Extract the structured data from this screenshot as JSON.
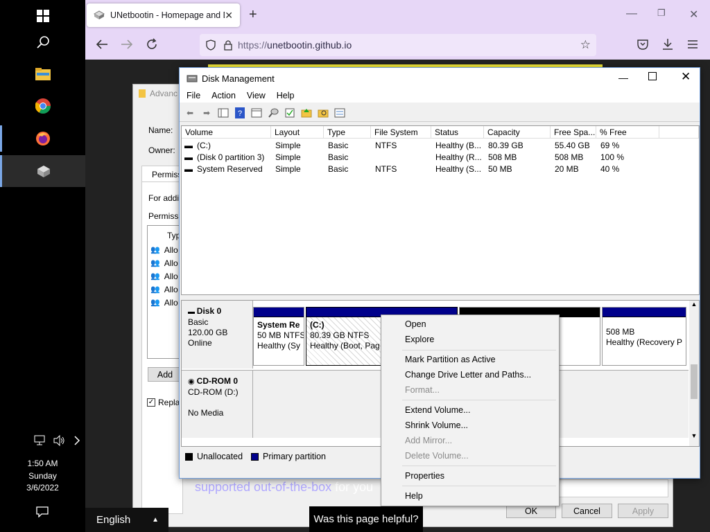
{
  "taskbar": {
    "clock_time": "1:50 AM",
    "clock_day": "Sunday",
    "clock_date": "3/6/2022"
  },
  "browser": {
    "tab_title": "UNetbootin - Homepage and D",
    "url_prefix": "https://",
    "url_host": "unetbootin.github.io",
    "page_text_link": "supported out-of-the-box",
    "page_text_rest": " for you",
    "helpful_label": "Was this page helpful?",
    "language_label": "English"
  },
  "adv_dialog": {
    "title": "Advanc",
    "name_label": "Name:",
    "owner_label": "Owner:",
    "tab_label": "Permiss",
    "for_addl": "For addi",
    "perm_label": "Permissi",
    "type_header": "Typ",
    "entries": [
      "Allo",
      "Allo",
      "Allo",
      "Allo",
      "Allo"
    ],
    "add_btn": "Add",
    "replace_chk": "Replac",
    "ok_btn": "OK",
    "cancel_btn": "Cancel",
    "apply_btn": "Apply"
  },
  "disk_mgmt": {
    "title": "Disk Management",
    "menu": [
      "File",
      "Action",
      "View",
      "Help"
    ],
    "columns": [
      "Volume",
      "Layout",
      "Type",
      "File System",
      "Status",
      "Capacity",
      "Free Spa...",
      "% Free"
    ],
    "rows": [
      [
        "(C:)",
        "Simple",
        "Basic",
        "NTFS",
        "Healthy (B...",
        "80.39 GB",
        "55.40 GB",
        "69 %"
      ],
      [
        "(Disk 0 partition 3)",
        "Simple",
        "Basic",
        "",
        "Healthy (R...",
        "508 MB",
        "508 MB",
        "100 %"
      ],
      [
        "System Reserved",
        "Simple",
        "Basic",
        "NTFS",
        "Healthy (S...",
        "50 MB",
        "20 MB",
        "40 %"
      ]
    ],
    "disk0": {
      "name": "Disk 0",
      "type": "Basic",
      "size": "120.00 GB",
      "state": "Online"
    },
    "cdrom0": {
      "name": "CD-ROM 0",
      "drive": "CD-ROM (D:)",
      "media": "No Media"
    },
    "partitions": {
      "sysres": {
        "name": "System Re",
        "size": "50 MB NTFS",
        "status": "Healthy (Sy"
      },
      "c": {
        "name": "(C:)",
        "size": "80.39 GB NTFS",
        "status": "Healthy (Boot, Pag"
      },
      "recovery": {
        "size": "508 MB",
        "status": "Healthy (Recovery P"
      }
    },
    "legend": {
      "unallocated": "Unallocated",
      "primary": "Primary partition"
    }
  },
  "context_menu": {
    "items": [
      {
        "label": "Open",
        "disabled": false
      },
      {
        "label": "Explore",
        "disabled": false
      },
      {
        "label": "Mark Partition as Active",
        "disabled": false
      },
      {
        "label": "Change Drive Letter and Paths...",
        "disabled": false
      },
      {
        "label": "Format...",
        "disabled": true
      },
      {
        "label": "Extend Volume...",
        "disabled": false
      },
      {
        "label": "Shrink Volume...",
        "disabled": false
      },
      {
        "label": "Add Mirror...",
        "disabled": true
      },
      {
        "label": "Delete Volume...",
        "disabled": true
      },
      {
        "label": "Properties",
        "disabled": false
      },
      {
        "label": "Help",
        "disabled": false
      }
    ]
  },
  "colors": {
    "primary_partition": "#00008b",
    "unallocated": "#000000",
    "browser_chrome": "#e7d7f7"
  }
}
